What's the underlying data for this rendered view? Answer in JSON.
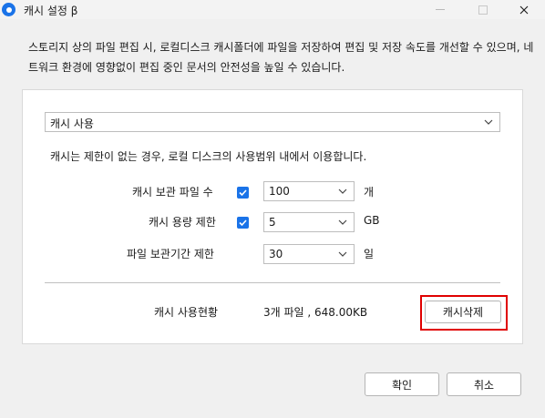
{
  "window": {
    "title": "캐시 설정 β"
  },
  "description": "스토리지 상의 파일 편집 시, 로컬디스크 캐시폴더에 파일을 저장하여 편집 및 저장 속도를 개선할 수 있으며, 네트워크 환경에 영향없이 편집 중인 문서의 안전성을 높일 수 있습니다.",
  "cache_mode": {
    "selected": "캐시 사용"
  },
  "info_text": "캐시는 제한이 없는 경우, 로컬 디스크의 사용범위 내에서 이용합니다.",
  "settings": [
    {
      "label": "캐시 보관 파일 수",
      "checked": true,
      "value": "100",
      "unit": "개"
    },
    {
      "label": "캐시 용량 제한",
      "checked": true,
      "value": "5",
      "unit": "GB"
    },
    {
      "label": "파일 보관기간 제한",
      "checked": false,
      "value": "30",
      "unit": "일"
    }
  ],
  "usage": {
    "label": "캐시 사용현황",
    "value": "3개 파일 , 648.00KB"
  },
  "buttons": {
    "clear": "캐시삭제",
    "ok": "확인",
    "cancel": "취소"
  },
  "colors": {
    "accent": "#1a73e8",
    "highlight": "#e00000"
  }
}
